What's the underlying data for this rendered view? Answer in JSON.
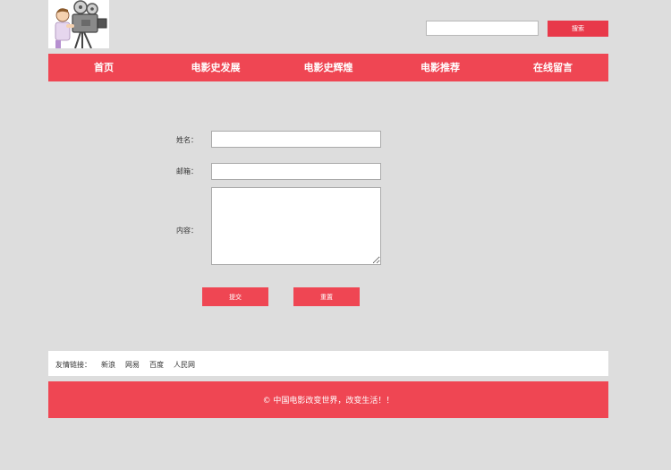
{
  "header": {
    "logo_icon": "movie-camera-cartoon-icon",
    "search": {
      "value": "",
      "placeholder": "",
      "button_label": "搜索"
    }
  },
  "nav": {
    "items": [
      {
        "label": "首页"
      },
      {
        "label": "电影史发展"
      },
      {
        "label": "电影史辉煌"
      },
      {
        "label": "电影推荐"
      },
      {
        "label": "在线留言"
      }
    ]
  },
  "form": {
    "name_label": "姓名：",
    "name_value": "",
    "email_label": "邮箱：",
    "email_value": "",
    "content_label": "内容：",
    "content_value": "",
    "submit_label": "提交",
    "reset_label": "重置"
  },
  "links": {
    "title": "友情链接：",
    "items": [
      {
        "label": "新浪"
      },
      {
        "label": "网易"
      },
      {
        "label": "百度"
      },
      {
        "label": "人民网"
      }
    ]
  },
  "footer": {
    "text": "© 中国电影改变世界，改变生活！！"
  },
  "colors": {
    "accent": "#ef4653",
    "page_background": "#dddddd"
  }
}
